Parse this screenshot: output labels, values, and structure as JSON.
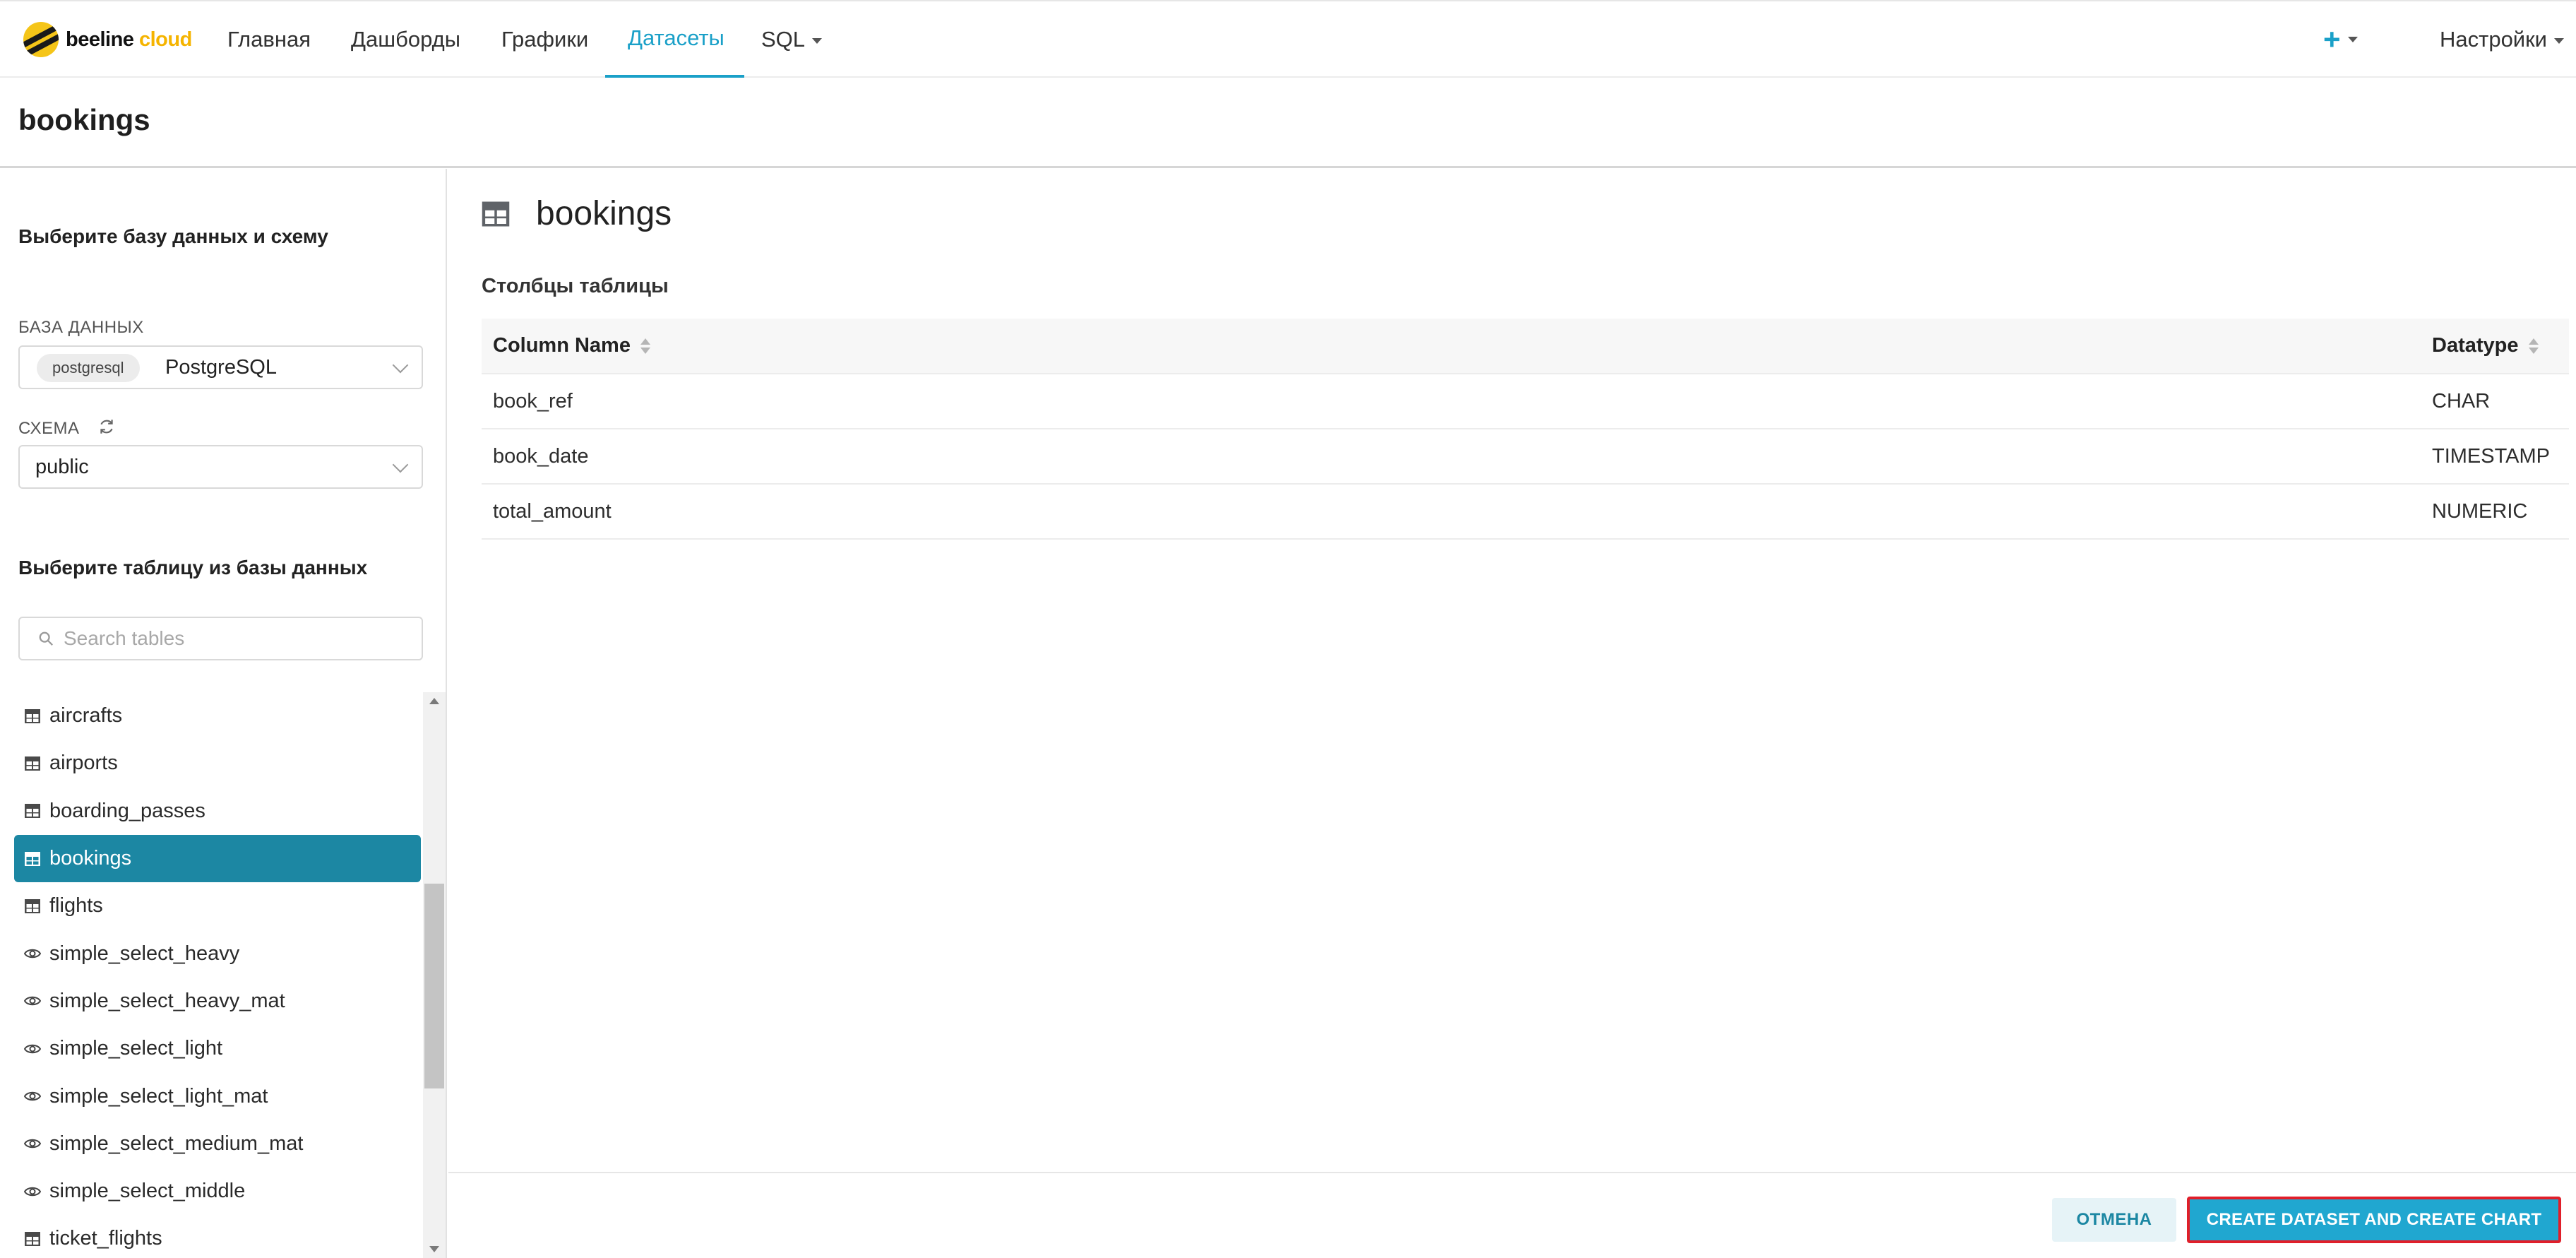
{
  "brand": {
    "name": "beeline",
    "suffix": "cloud"
  },
  "nav": {
    "items": [
      {
        "label": "Главная"
      },
      {
        "label": "Дашборды"
      },
      {
        "label": "Графики"
      },
      {
        "label": "Датасеты",
        "active": true
      },
      {
        "label": "SQL",
        "dropdown": true
      }
    ],
    "settings_label": "Настройки",
    "plus_icon": "plus-icon"
  },
  "page": {
    "title": "bookings"
  },
  "left": {
    "choose_db_heading": "Выберите базу данных и схему",
    "database_label": "БАЗА ДАННЫХ",
    "database_tag": "postgresql",
    "database_value": "PostgreSQL",
    "schema_label": "СХЕМА",
    "schema_value": "public",
    "choose_table_heading": "Выберите таблицу из базы данных",
    "search_placeholder": "Search tables",
    "tables": [
      {
        "name": "aircrafts",
        "kind": "table"
      },
      {
        "name": "airports",
        "kind": "table"
      },
      {
        "name": "boarding_passes",
        "kind": "table"
      },
      {
        "name": "bookings",
        "kind": "table",
        "selected": true
      },
      {
        "name": "flights",
        "kind": "table"
      },
      {
        "name": "simple_select_heavy",
        "kind": "view"
      },
      {
        "name": "simple_select_heavy_mat",
        "kind": "view"
      },
      {
        "name": "simple_select_light",
        "kind": "view"
      },
      {
        "name": "simple_select_light_mat",
        "kind": "view"
      },
      {
        "name": "simple_select_medium_mat",
        "kind": "view"
      },
      {
        "name": "simple_select_middle",
        "kind": "view"
      },
      {
        "name": "ticket_flights",
        "kind": "table"
      }
    ]
  },
  "right": {
    "table_name": "bookings",
    "columns_label": "Столбцы таблицы",
    "headers": {
      "name": "Column Name",
      "type": "Datatype"
    },
    "rows": [
      {
        "name": "book_ref",
        "type": "CHAR"
      },
      {
        "name": "book_date",
        "type": "TIMESTAMP"
      },
      {
        "name": "total_amount",
        "type": "NUMERIC"
      }
    ]
  },
  "footer": {
    "cancel_label": "ОТМЕНА",
    "create_label": "CREATE DATASET AND CREATE CHART"
  },
  "colors": {
    "accent": "#1aa0c8",
    "selected_row": "#1c87a3",
    "brand_yellow": "#f5c518",
    "highlight_border": "#e01f2a"
  }
}
